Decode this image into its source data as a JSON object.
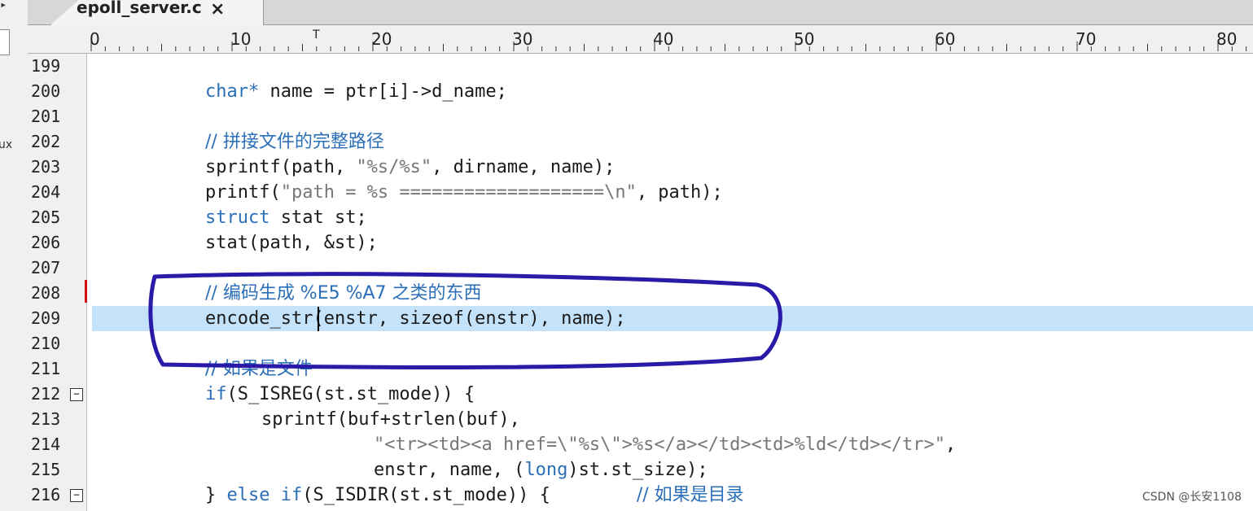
{
  "left_panel": {
    "arrow": "▸",
    "partial_text": "ux"
  },
  "tab": {
    "title": "epoll_server.c",
    "close": "×"
  },
  "ruler": {
    "labels": [
      "0",
      "10",
      "20",
      "30",
      "40",
      "50",
      "60",
      "70",
      "80"
    ]
  },
  "editor": {
    "line_numbers": [
      "199",
      "200",
      "201",
      "202",
      "203",
      "204",
      "205",
      "206",
      "207",
      "208",
      "209",
      "210",
      "211",
      "212",
      "213",
      "214",
      "215",
      "216"
    ],
    "fold_markers": [
      "212",
      "216"
    ],
    "bookmark_line": "208",
    "current_line": "209"
  },
  "code": {
    "l200": {
      "kw": "char*",
      "rest": " name = ptr[i]->d_name;"
    },
    "l202": {
      "comment": "// 拼接文件的完整路径"
    },
    "l203": {
      "a": "sprintf(path, ",
      "str": "\"%s/%s\"",
      "b": ", dirname, name);"
    },
    "l204": {
      "a": "printf(",
      "str": "\"path = %s ===================\\n\"",
      "b": ", path);"
    },
    "l205": {
      "kw": "struct",
      "rest": " stat st;"
    },
    "l206": {
      "text": "stat(path, &st);"
    },
    "l208": {
      "comment": "// 编码生成 %E5 %A7 之类的东西"
    },
    "l209": {
      "text": "encode_str(enstr, sizeof(enstr), name);"
    },
    "l211": {
      "comment": "// 如果是文件"
    },
    "l212": {
      "kw": "if",
      "rest": "(S_ISREG(st.st_mode)) {"
    },
    "l213": {
      "text": "sprintf(buf+strlen(buf),"
    },
    "l214": {
      "str": "\"<tr><td><a href=\\\"%s\\\">%s</a></td><td>%ld</td></tr>\"",
      "b": ","
    },
    "l215": {
      "a": "enstr, name, (",
      "kw": "long",
      "b": ")st.st_size);"
    },
    "l216": {
      "a": "} ",
      "kw1": "else",
      "mid": " ",
      "kw2": "if",
      "b": "(S_ISDIR(st.st_mode)) {",
      "comment": "// 如果是目录"
    }
  },
  "watermark": "CSDN @长安1108",
  "colors": {
    "keyword": "#2b6fb8",
    "string": "#777777",
    "highlight": "#c5e2fb",
    "annotation": "#2a1aa8",
    "bookmark": "#d01010"
  }
}
